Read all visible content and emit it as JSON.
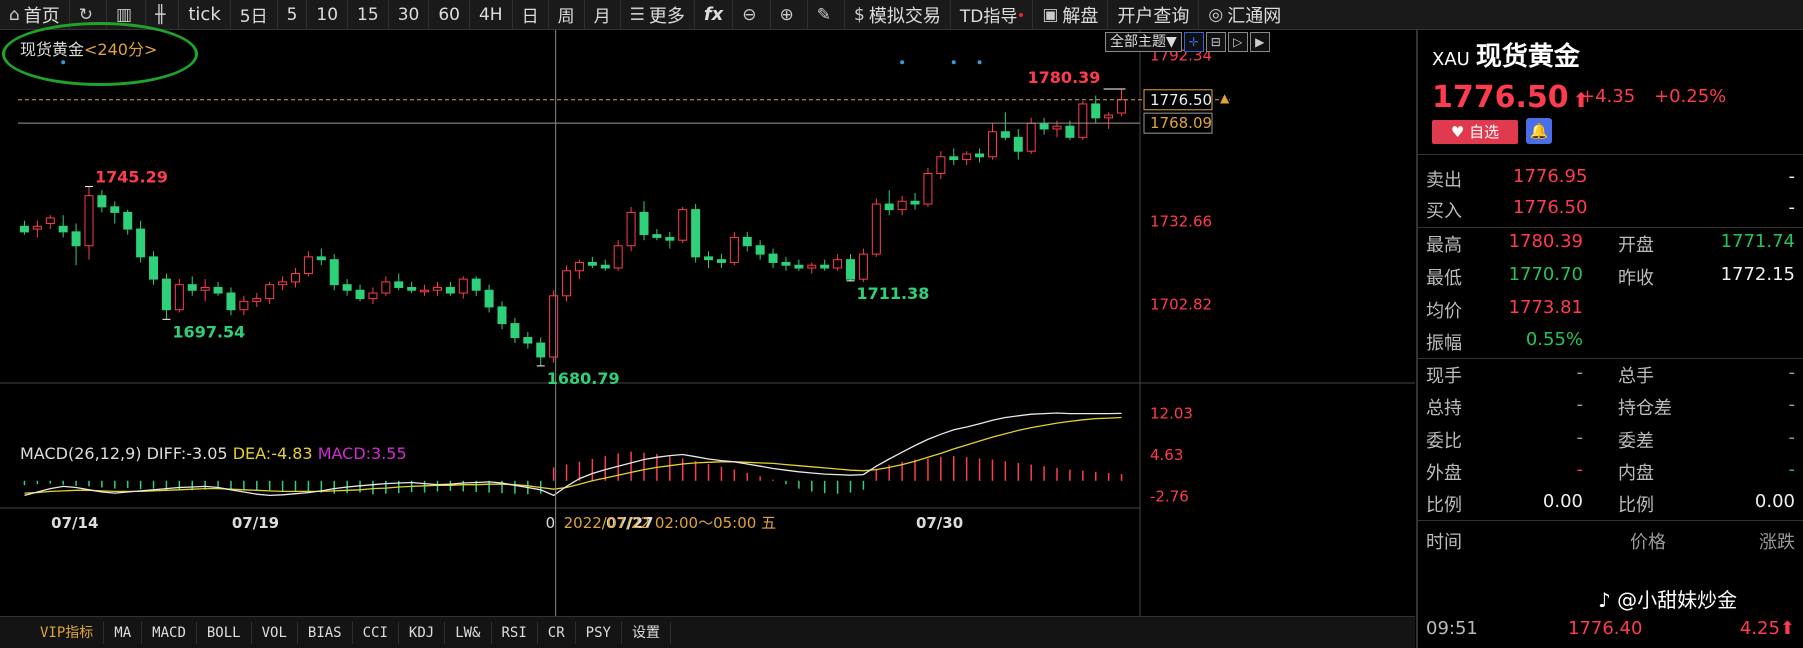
{
  "toolbar": {
    "home": "首页",
    "tick": "tick",
    "periods": [
      "5日",
      "5",
      "10",
      "15",
      "30",
      "60",
      "4H",
      "日",
      "周",
      "月"
    ],
    "more": "更多",
    "fx": "fx",
    "sim_trade": "模拟交易",
    "td_guide": "TD指导",
    "analysis": "解盘",
    "account_query": "开户查询",
    "brand": "汇通网"
  },
  "chart": {
    "title": "现货黄金",
    "period": "<240分>",
    "theme_button": "全部主题▼",
    "price_axis": [
      "1792.34",
      "1780.39",
      "1732.66",
      "1702.82"
    ],
    "current_price_tag": "1776.50",
    "crosshair_price_tag": "1768.09",
    "annotations": {
      "high_label": "1745.29",
      "low_label_1": "1697.54",
      "low_label_2": "1680.79",
      "low_label_3": "1711.38",
      "last_high_label": "1780.39"
    },
    "x_labels": [
      "07/14",
      "07/19",
      "07/27",
      "07/30"
    ],
    "crosshair_time": "2022/07/22 02:00～05:00 五",
    "crosshair_left": "0",
    "macd": {
      "name": "MACD(26,12,9)",
      "diff": "DIFF:-3.05",
      "dea": "DEA:-4.83",
      "macd": "MACD:3.55",
      "axis": [
        "12.03",
        "4.63",
        "-2.76"
      ]
    }
  },
  "tabs": [
    "VIP指标",
    "MA",
    "MACD",
    "BOLL",
    "VOL",
    "BIAS",
    "CCI",
    "KDJ",
    "LW&",
    "RSI",
    "CR",
    "PSY",
    "设置"
  ],
  "quote": {
    "code": "XAU",
    "name": "现货黄金",
    "price": "1776.50",
    "arrow": "⬆",
    "change": "+4.35",
    "change_pct": "+0.25%",
    "fav_button": "自选",
    "sell_label": "卖出",
    "sell_value": "1776.95",
    "sell_dash": "-",
    "buy_label": "买入",
    "buy_value": "1776.50",
    "buy_dash": "-",
    "high_label": "最高",
    "high_value": "1780.39",
    "open_label": "开盘",
    "open_value": "1771.74",
    "low_label": "最低",
    "low_value": "1770.70",
    "prev_close_label": "昨收",
    "prev_close_value": "1772.15",
    "avg_label": "均价",
    "avg_value": "1773.81",
    "amp_label": "振幅",
    "amp_value": "0.55%",
    "cur_hand_label": "现手",
    "cur_hand_value": "-",
    "total_hand_label": "总手",
    "total_hand_value": "-",
    "total_hold_label": "总持",
    "total_hold_value": "-",
    "hold_diff_label": "持仓差",
    "hold_diff_value": "-",
    "ratio_label": "委比",
    "ratio_value": "-",
    "diff_label": "委差",
    "diff_value": "-",
    "outer_label": "外盘",
    "outer_value": "-",
    "inner_label": "内盘",
    "inner_value": "-",
    "prop1_label": "比例",
    "prop1_value": "0.00",
    "prop2_label": "比例",
    "prop2_value": "0.00",
    "trade_header": {
      "time": "时间",
      "price": "价格",
      "change": "涨跌"
    },
    "last_trade": {
      "time": "09:51",
      "price": "1776.40",
      "change": "4.25"
    }
  },
  "watermark": "@小甜妹炒金",
  "chart_data": {
    "type": "candlestick",
    "price_range": [
      1675,
      1798
    ],
    "candles": [
      [
        1731,
        1733,
        1728,
        1729
      ],
      [
        1730,
        1733,
        1727,
        1731
      ],
      [
        1732,
        1735,
        1730,
        1734
      ],
      [
        1731,
        1735,
        1727,
        1729
      ],
      [
        1729,
        1732,
        1717,
        1724
      ],
      [
        1724,
        1745.29,
        1719,
        1742
      ],
      [
        1742,
        1744,
        1736,
        1738
      ],
      [
        1738,
        1740,
        1732,
        1736
      ],
      [
        1736,
        1737,
        1728,
        1730
      ],
      [
        1730,
        1733,
        1718,
        1720
      ],
      [
        1720,
        1722,
        1710,
        1712
      ],
      [
        1712,
        1714,
        1697.54,
        1701
      ],
      [
        1701,
        1712,
        1700,
        1710
      ],
      [
        1710,
        1713,
        1706,
        1708
      ],
      [
        1708,
        1712,
        1704,
        1709
      ],
      [
        1709,
        1711,
        1706,
        1707
      ],
      [
        1707,
        1709,
        1699,
        1701
      ],
      [
        1701,
        1706,
        1699,
        1704
      ],
      [
        1704,
        1707,
        1702,
        1705
      ],
      [
        1705,
        1711,
        1703,
        1710
      ],
      [
        1710,
        1713,
        1708,
        1711
      ],
      [
        1711,
        1716,
        1709,
        1714
      ],
      [
        1714,
        1722,
        1713,
        1720
      ],
      [
        1720,
        1723,
        1717,
        1719
      ],
      [
        1719,
        1721,
        1708,
        1710
      ],
      [
        1710,
        1712,
        1706,
        1708
      ],
      [
        1708,
        1710,
        1704,
        1705
      ],
      [
        1705,
        1709,
        1703,
        1707
      ],
      [
        1707,
        1713,
        1706,
        1711
      ],
      [
        1711,
        1714,
        1708,
        1709
      ],
      [
        1709,
        1711,
        1707,
        1708
      ],
      [
        1708,
        1710,
        1706,
        1708
      ],
      [
        1708,
        1711,
        1706,
        1709
      ],
      [
        1709,
        1711,
        1706,
        1707
      ],
      [
        1707,
        1713,
        1705,
        1712
      ],
      [
        1712,
        1713,
        1706,
        1708
      ],
      [
        1708,
        1710,
        1700,
        1702
      ],
      [
        1702,
        1704,
        1694,
        1696
      ],
      [
        1696,
        1698,
        1689,
        1691
      ],
      [
        1691,
        1693,
        1687,
        1689
      ],
      [
        1689,
        1691,
        1680.79,
        1684
      ],
      [
        1684,
        1708,
        1682,
        1706
      ],
      [
        1706,
        1717,
        1704,
        1715
      ],
      [
        1715,
        1719,
        1712,
        1718
      ],
      [
        1718,
        1720,
        1716,
        1717
      ],
      [
        1717,
        1719,
        1715,
        1716
      ],
      [
        1716,
        1726,
        1715,
        1724
      ],
      [
        1724,
        1738,
        1722,
        1736
      ],
      [
        1736,
        1740,
        1726,
        1728
      ],
      [
        1728,
        1730,
        1726,
        1727
      ],
      [
        1727,
        1729,
        1723,
        1726
      ],
      [
        1726,
        1738,
        1725,
        1737
      ],
      [
        1737,
        1739,
        1718,
        1720
      ],
      [
        1720,
        1722,
        1716,
        1719
      ],
      [
        1719,
        1721,
        1716,
        1718
      ],
      [
        1718,
        1729,
        1717,
        1727
      ],
      [
        1727,
        1729,
        1722,
        1724
      ],
      [
        1724,
        1726,
        1719,
        1721
      ],
      [
        1721,
        1723,
        1716,
        1718
      ],
      [
        1718,
        1720,
        1715,
        1717
      ],
      [
        1717,
        1719,
        1715,
        1716
      ],
      [
        1716,
        1718,
        1714,
        1717
      ],
      [
        1717,
        1719,
        1715,
        1716
      ],
      [
        1716,
        1721,
        1715,
        1719
      ],
      [
        1719,
        1721,
        1711.38,
        1712
      ],
      [
        1712,
        1723,
        1711,
        1721
      ],
      [
        1721,
        1741,
        1720,
        1739
      ],
      [
        1739,
        1744,
        1735,
        1737
      ],
      [
        1737,
        1742,
        1735,
        1740
      ],
      [
        1740,
        1743,
        1737,
        1739
      ],
      [
        1739,
        1752,
        1738,
        1750
      ],
      [
        1750,
        1758,
        1748,
        1756
      ],
      [
        1756,
        1759,
        1753,
        1755
      ],
      [
        1755,
        1758,
        1753,
        1757
      ],
      [
        1757,
        1759,
        1754,
        1756
      ],
      [
        1756,
        1768,
        1755,
        1765
      ],
      [
        1765,
        1772,
        1762,
        1763
      ],
      [
        1763,
        1766,
        1755,
        1758
      ],
      [
        1758,
        1770,
        1757,
        1768
      ],
      [
        1768,
        1770,
        1764,
        1766
      ],
      [
        1766,
        1769,
        1763,
        1767
      ],
      [
        1767,
        1769,
        1762,
        1763
      ],
      [
        1763,
        1776,
        1762,
        1775
      ],
      [
        1775,
        1778,
        1768,
        1770
      ],
      [
        1770,
        1772,
        1766,
        1771
      ],
      [
        1771.74,
        1780.39,
        1770.7,
        1776.5
      ]
    ],
    "macd_hist": [
      -0.8,
      -0.6,
      -0.5,
      -0.7,
      -0.9,
      -1.0,
      -1.2,
      -1.4,
      -1.3,
      -1.5,
      -1.4,
      -1.6,
      -1.5,
      -1.7,
      -1.6,
      -1.5,
      -1.7,
      -1.6,
      -1.8,
      -1.7,
      -1.9,
      -2.0,
      -2.2,
      -2.1,
      -2.3,
      -2.2,
      -2.1,
      -2.4,
      -2.3,
      -2.2,
      -2.0,
      -2.1,
      -1.9,
      -1.8,
      -1.9,
      -2.0,
      -2.1,
      -2.2,
      -2.3,
      -2.4,
      -2.3,
      2.4,
      2.9,
      3.4,
      3.9,
      4.4,
      4.9,
      5.2,
      5.0,
      4.8,
      4.4,
      4.0,
      3.5,
      3.0,
      2.5,
      2.0,
      1.4,
      0.8,
      0.2,
      -0.6,
      -1.4,
      -1.9,
      -2.2,
      -2.3,
      -2.1,
      -1.6,
      2.1,
      2.8,
      3.4,
      3.8,
      4.0,
      4.3,
      4.4,
      4.2,
      4.0,
      3.8,
      3.5,
      3.2,
      2.9,
      2.6,
      2.3,
      2.0,
      1.8,
      1.6,
      1.4,
      1.2
    ],
    "macd_diff": [
      -2.6,
      -2.0,
      -1.4,
      -1.0,
      -1.2,
      -1.6,
      -2.0,
      -2.2,
      -2.0,
      -1.8,
      -1.6,
      -1.4,
      -1.2,
      -1.1,
      -1.0,
      -1.2,
      -1.6,
      -2.0,
      -2.4,
      -2.6,
      -2.5,
      -2.3,
      -2.1,
      -1.8,
      -1.4,
      -1.1,
      -0.9,
      -0.7,
      -0.5,
      -0.4,
      -0.3,
      -0.5,
      -0.7,
      -0.6,
      -0.4,
      -0.3,
      -0.2,
      -0.4,
      -0.8,
      -1.2,
      -1.6,
      -2.6,
      -1.0,
      0.4,
      1.3,
      2.0,
      2.6,
      3.2,
      3.8,
      4.2,
      4.5,
      4.7,
      4.3,
      3.9,
      3.6,
      3.4,
      3.0,
      2.6,
      2.2,
      1.9,
      1.6,
      1.4,
      1.2,
      1.1,
      1.0,
      1.1,
      2.6,
      3.9,
      5.1,
      6.3,
      7.4,
      8.3,
      9.1,
      9.6,
      10.2,
      10.8,
      11.3,
      11.6,
      11.9,
      12.0,
      12.1,
      12.0,
      12.0,
      12.0,
      12.0,
      12.03
    ],
    "macd_dea": [
      -2.2,
      -2.1,
      -1.9,
      -1.8,
      -1.7,
      -1.7,
      -1.8,
      -1.9,
      -1.9,
      -1.9,
      -1.8,
      -1.7,
      -1.6,
      -1.5,
      -1.4,
      -1.4,
      -1.5,
      -1.6,
      -1.7,
      -1.8,
      -1.9,
      -1.9,
      -1.9,
      -1.9,
      -1.8,
      -1.7,
      -1.6,
      -1.4,
      -1.3,
      -1.1,
      -1.0,
      -0.9,
      -0.8,
      -0.8,
      -0.7,
      -0.7,
      -0.6,
      -0.6,
      -0.7,
      -0.9,
      -1.2,
      -1.5,
      -1.2,
      -0.6,
      0.0,
      0.5,
      1.0,
      1.5,
      2.0,
      2.4,
      2.7,
      3.0,
      3.2,
      3.3,
      3.4,
      3.4,
      3.3,
      3.2,
      3.1,
      2.9,
      2.7,
      2.5,
      2.3,
      2.1,
      1.9,
      1.8,
      2.0,
      2.4,
      2.9,
      3.5,
      4.2,
      4.9,
      5.7,
      6.4,
      7.1,
      7.8,
      8.4,
      9.0,
      9.5,
      9.9,
      10.3,
      10.6,
      10.9,
      11.1,
      11.2,
      11.3
    ]
  }
}
